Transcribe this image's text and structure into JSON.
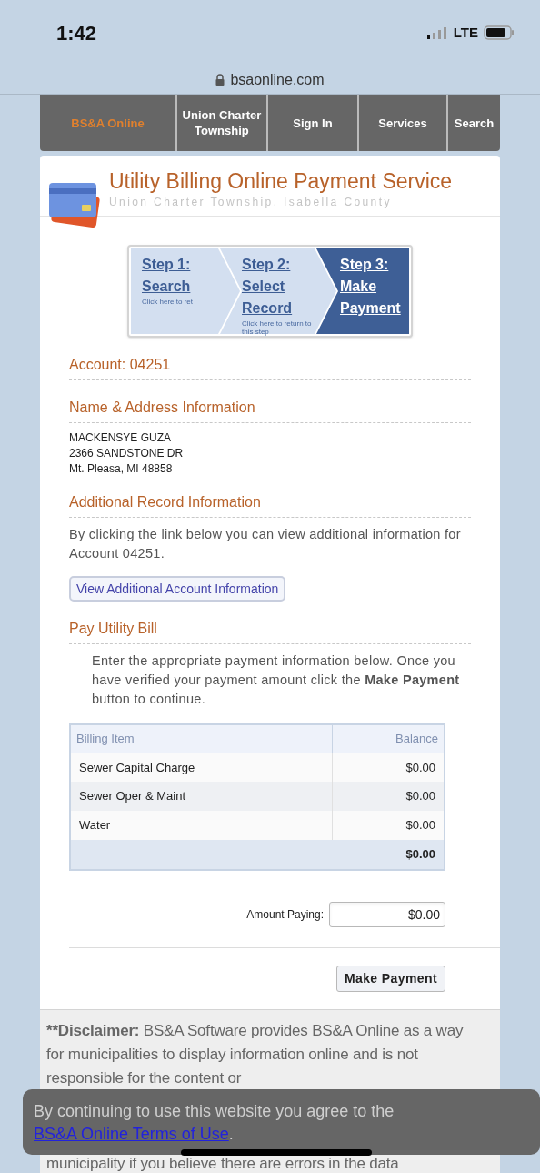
{
  "status_bar": {
    "time": "1:42",
    "network": "LTE"
  },
  "browser": {
    "url": "bsaonline.com"
  },
  "nav": {
    "items": [
      {
        "label": "BS&A Online",
        "kind": "brand"
      },
      {
        "label": "Union Charter Township",
        "kind": "link"
      },
      {
        "label": "Sign In",
        "kind": "link"
      },
      {
        "label": "Services",
        "kind": "link"
      },
      {
        "label": "Search",
        "kind": "link"
      }
    ]
  },
  "header": {
    "title": "Utility Billing Online Payment Service",
    "subtitle": "Union Charter Township, Isabella County"
  },
  "steps": [
    {
      "title": "Step 1:",
      "name": "Search",
      "hint": "Click here to ret",
      "selected": false
    },
    {
      "title": "Step 2:",
      "name": "Select Record",
      "hint": "Click here to return to this step",
      "selected": false
    },
    {
      "title": "Step 3:",
      "name": "Make Payment",
      "selected": true
    }
  ],
  "account": "Account: 04251",
  "name_address": {
    "heading": "Name & Address Information",
    "lines": [
      "MACKENSYE GUZA",
      "2366 SANDSTONE DR",
      "Mt. Pleasa, MI 48858"
    ]
  },
  "additional": {
    "heading": "Additional Record Information",
    "text": "By clicking the link below you can view additional information for Account 04251.",
    "button": "View Additional Account Information"
  },
  "pay": {
    "heading": "Pay Utility Bill",
    "instructions": "Enter the appropriate payment information below. Once you have verified your payment amount click the **Make Payment** button to continue.",
    "table": {
      "columns": [
        "Billing Item",
        "Balance"
      ],
      "rows": [
        [
          "Sewer Capital Charge",
          "$0.00"
        ],
        [
          "Sewer Oper & Maint",
          "$0.00"
        ],
        [
          "Water",
          "$0.00"
        ]
      ],
      "total": "$0.00"
    },
    "amount_label": "Amount Paying:",
    "amount_value": "$0.00",
    "submit": "Make Payment"
  },
  "disclaimer": {
    "label": "**Disclaimer:",
    "text": "BS&A Software provides BS&A Online as a way for municipalities to display information online and is not responsible for the content or",
    "last_line": "municipality if you believe there are errors in the data"
  },
  "cookie_banner": {
    "text": "By continuing to use this website you agree to the",
    "link": "BS&A Online Terms of Use",
    "end": "."
  }
}
